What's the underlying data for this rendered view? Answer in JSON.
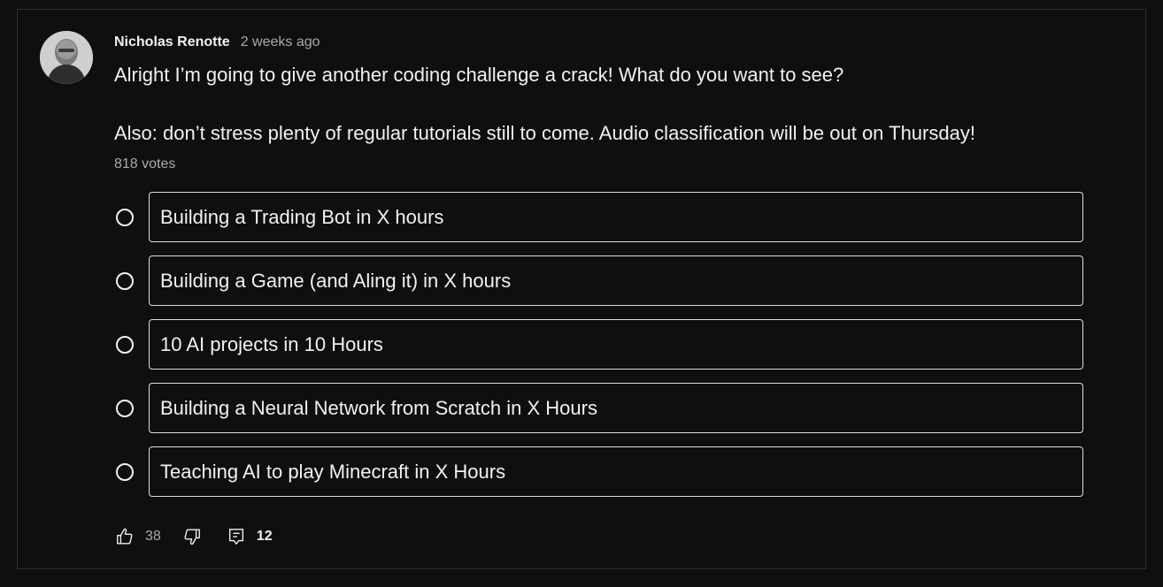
{
  "post": {
    "author": "Nicholas Renotte",
    "time": "2 weeks ago",
    "text_line1": "Alright I’m going to give another coding challenge a crack! What do you want to see?",
    "text_line2": "Also: don’t stress plenty of regular tutorials still to come. Audio classification will be out on Thursday!",
    "votes": "818 votes"
  },
  "poll": {
    "options": [
      "Building a Trading Bot in X hours",
      "Building a Game (and Aling it) in X hours",
      "10 AI projects in 10 Hours",
      "Building a Neural Network from Scratch in X Hours",
      "Teaching AI to play Minecraft in X Hours"
    ]
  },
  "actions": {
    "likes": "38",
    "comments": "12"
  },
  "icons": {
    "like": "thumbs-up-icon",
    "dislike": "thumbs-down-icon",
    "comment": "comment-icon"
  },
  "colors": {
    "background": "#0f0f0f",
    "text": "#f1f1f1",
    "secondary_text": "#aaaaaa",
    "border": "#303030"
  }
}
